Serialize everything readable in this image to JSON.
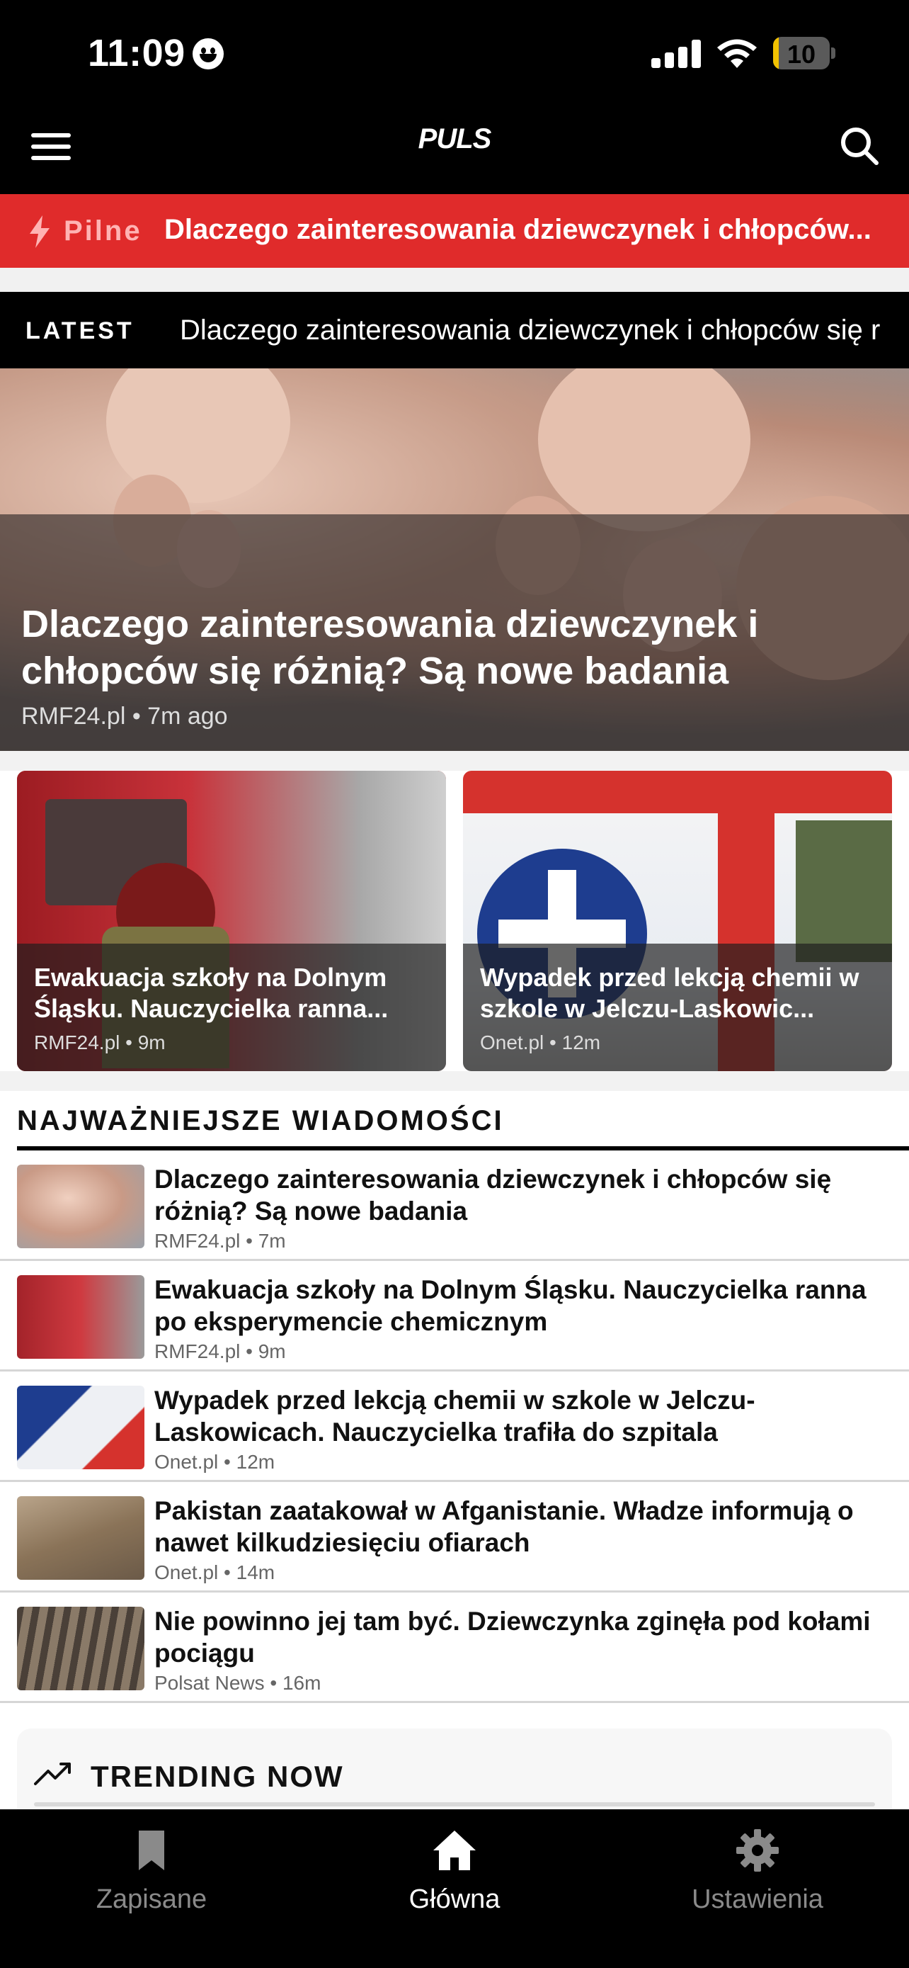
{
  "status_bar": {
    "time": "11:09",
    "battery": "10",
    "battery_level": 0.1
  },
  "header": {
    "logo": "PULS"
  },
  "breaking": {
    "label": "Pilne",
    "text": "Dlaczego zainteresowania dziewczynek i chłopców..."
  },
  "latest": {
    "label": "LATEST",
    "text": "Dlaczego zainteresowania dziewczynek i chłopców się r"
  },
  "hero": {
    "title": "Dlaczego zainteresowania dziewczynek i chłopców się różnią? Są nowe badania",
    "meta": "RMF24.pl • 7m ago"
  },
  "cards": [
    {
      "title": "Ewakuacja szkoły na Dolnym Śląsku. Nauczycielka ranna...",
      "meta": "RMF24.pl • 9m",
      "image": "firefighter-truck"
    },
    {
      "title": "Wypadek przed lekcją chemii w szkole w Jelczu-Laskowic...",
      "meta": "Onet.pl • 12m",
      "image": "ambulance"
    }
  ],
  "top_news": {
    "title": "NAJWAŻNIEJSZE WIADOMOŚCI",
    "items": [
      {
        "title": "Dlaczego zainteresowania dziewczynek i chłopców się różnią? Są nowe badania",
        "meta": "RMF24.pl • 7m",
        "image": "baby-feet"
      },
      {
        "title": "Ewakuacja szkoły na Dolnym Śląsku. Nauczycielka ranna po eksperymencie chemicznym",
        "meta": "RMF24.pl • 9m",
        "image": "firefighter"
      },
      {
        "title": "Wypadek przed lekcją chemii w szkole w Jelczu-Laskowicach. Nauczycielka trafiła do szpitala",
        "meta": "Onet.pl • 12m",
        "image": "ambulance"
      },
      {
        "title": "Pakistan zaatakował w Afganistanie. Władze informują o nawet kilkudziesięciu ofiarach",
        "meta": "Onet.pl • 14m",
        "image": "rubble"
      },
      {
        "title": "Nie powinno jej tam być. Dziewczynka zginęła pod kołami pociągu",
        "meta": "Polsat News • 16m",
        "image": "railway-tracks"
      }
    ]
  },
  "trending": {
    "title": "TRENDING NOW"
  },
  "bottom_nav": [
    {
      "label": "Zapisane",
      "icon": "bookmark-icon",
      "active": false
    },
    {
      "label": "Główna",
      "icon": "home-icon",
      "active": true
    },
    {
      "label": "Ustawienia",
      "icon": "gear-icon",
      "active": false
    }
  ],
  "colors": {
    "breaking_red": "#e02b2b",
    "background_dark": "#000000"
  }
}
